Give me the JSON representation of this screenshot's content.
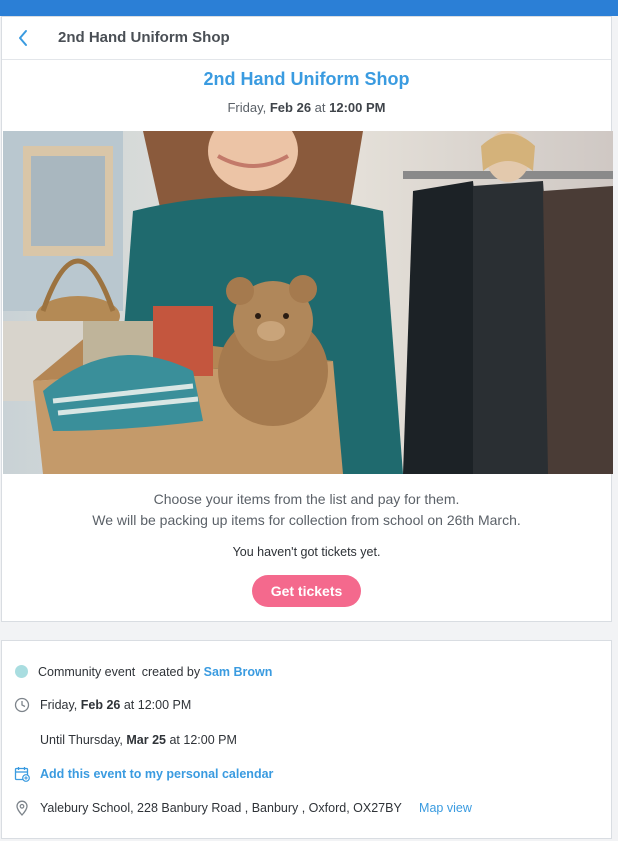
{
  "header": {
    "title": "2nd Hand Uniform Shop"
  },
  "event": {
    "title": "2nd Hand Uniform Shop",
    "date_prefix": "Friday,",
    "date_bold": "Feb 26",
    "date_at": "at",
    "date_time": "12:00 PM",
    "description_line1": "Choose your items from the list and pay for them.",
    "description_line2": "We will be packing up items for collection from school on 26th March.",
    "tickets_status": "You haven't got tickets yet.",
    "get_tickets_label": "Get tickets"
  },
  "details": {
    "type_label": "Community event",
    "created_by_label": "created by",
    "creator_name": "Sam Brown",
    "start_prefix": "Friday,",
    "start_bold": "Feb 26",
    "start_suffix": "at 12:00 PM",
    "end_prefix": "Until Thursday,",
    "end_bold": "Mar 25",
    "end_suffix": "at 12:00 PM",
    "calendar_link": "Add this event to my personal calendar",
    "address": "Yalebury School, 228 Banbury Road , Banbury , Oxford, OX27BY",
    "map_link": "Map view"
  },
  "icons": {
    "back": "chevron-left-icon",
    "type_dot": "community-dot-icon",
    "clock": "clock-icon",
    "calendar": "calendar-add-icon",
    "location": "map-pin-icon"
  },
  "colors": {
    "accent": "#3a9be0",
    "button": "#f4698d",
    "topbar": "#2b7fd6",
    "dot": "#a9dde0"
  }
}
